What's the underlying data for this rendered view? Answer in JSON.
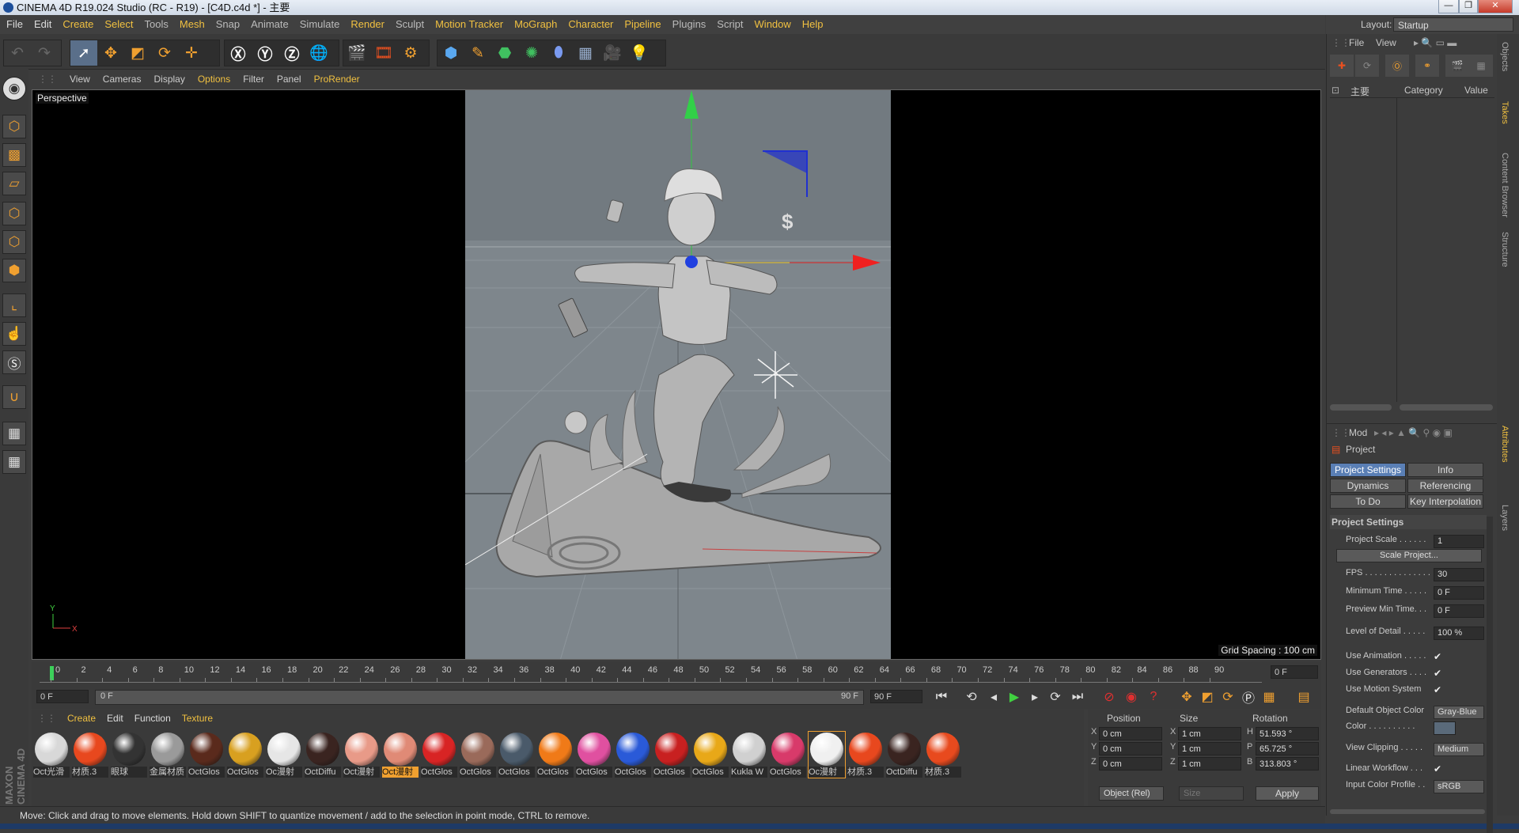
{
  "window": {
    "title": "CINEMA 4D R19.024 Studio (RC - R19) - [C4D.c4d *] - 主要"
  },
  "menubar": [
    "File",
    "Edit",
    "Create",
    "Select",
    "Tools",
    "Mesh",
    "Snap",
    "Animate",
    "Simulate",
    "Render",
    "Sculpt",
    "Motion Tracker",
    "MoGraph",
    "Character",
    "Pipeline",
    "Plugins",
    "Script",
    "Window",
    "Help"
  ],
  "layout": {
    "label": "Layout:",
    "value": "Startup"
  },
  "viewport": {
    "menu": [
      "View",
      "Cameras",
      "Display",
      "Options",
      "Filter",
      "Panel",
      "ProRender"
    ],
    "camera_label": "Perspective",
    "grid_spacing": "Grid Spacing : 100 cm",
    "axis_y": "Y",
    "axis_x": "X"
  },
  "timeline": {
    "ticks": [
      "0",
      "2",
      "4",
      "6",
      "8",
      "10",
      "12",
      "14",
      "16",
      "18",
      "20",
      "22",
      "24",
      "26",
      "28",
      "30",
      "32",
      "34",
      "36",
      "38",
      "40",
      "42",
      "44",
      "46",
      "48",
      "50",
      "52",
      "54",
      "56",
      "58",
      "60",
      "62",
      "64",
      "66",
      "68",
      "70",
      "72",
      "74",
      "76",
      "78",
      "80",
      "82",
      "84",
      "86",
      "88",
      "90"
    ],
    "current_frame": "0 F",
    "start": "0 F",
    "range_start": "0 F",
    "range_end": "90 F",
    "end": "90 F"
  },
  "materials": {
    "menu": [
      "Create",
      "Edit",
      "Function",
      "Texture"
    ],
    "items": [
      {
        "label": "Oct光滑",
        "color": "#d8d8d8"
      },
      {
        "label": "材质.3",
        "color": "#e8481e"
      },
      {
        "label": "眼球",
        "color": "#333333"
      },
      {
        "label": "金属材质",
        "color": "#9a9a9a"
      },
      {
        "label": "OctGlos",
        "color": "#5a2a1c"
      },
      {
        "label": "OctGlos",
        "color": "#d8a020"
      },
      {
        "label": "Oc漫射",
        "color": "#e6e6e6"
      },
      {
        "label": "OctDiffu",
        "color": "#3a2420"
      },
      {
        "label": "Oct漫射",
        "color": "#e89a88"
      },
      {
        "label": "Oct漫射",
        "color": "#e08a76"
      },
      {
        "label": "OctGlos",
        "color": "#d82424"
      },
      {
        "label": "OctGlos",
        "color": "#9a6a5a"
      },
      {
        "label": "OctGlos",
        "color": "#4a5a6a"
      },
      {
        "label": "OctGlos",
        "color": "#f07a18"
      },
      {
        "label": "OctGlos",
        "color": "#e050a0"
      },
      {
        "label": "OctGlos",
        "color": "#2a5ad8"
      },
      {
        "label": "OctGlos",
        "color": "#c82020"
      },
      {
        "label": "OctGlos",
        "color": "#e8a818"
      },
      {
        "label": "Kukla W",
        "color": "#d0d0d0"
      },
      {
        "label": "OctGlos",
        "color": "#d83a6a"
      },
      {
        "label": "Oc漫射",
        "color": "#f0f0f0"
      },
      {
        "label": "材质.3",
        "color": "#e8481e"
      },
      {
        "label": "OctDiffu",
        "color": "#3a2420"
      },
      {
        "label": "材质.3",
        "color": "#e84a1e"
      }
    ]
  },
  "coords": {
    "headers": [
      "Position",
      "Size",
      "Rotation"
    ],
    "rows": [
      {
        "axis": "X",
        "pos": "0 cm",
        "sz_axis": "X",
        "size": "1 cm",
        "rot_axis": "H",
        "rot": "51.593 °"
      },
      {
        "axis": "Y",
        "pos": "0 cm",
        "sz_axis": "Y",
        "size": "1 cm",
        "rot_axis": "P",
        "rot": "65.725 °"
      },
      {
        "axis": "Z",
        "pos": "0 cm",
        "sz_axis": "Z",
        "size": "1 cm",
        "rot_axis": "B",
        "rot": "313.803 °"
      }
    ],
    "mode": "Object (Rel)",
    "size_mode": "Size",
    "apply": "Apply"
  },
  "status": "Move: Click and drag to move elements. Hold down SHIFT to quantize movement / add to the selection in point mode, CTRL to remove.",
  "objects_panel": {
    "menu": [
      "File",
      "View"
    ],
    "col_name": "主要",
    "col_category": "Category",
    "col_value": "Value"
  },
  "attributes": {
    "mode": "Mod",
    "section": "Project",
    "tabs": [
      "Project Settings",
      "Info",
      "Dynamics",
      "Referencing",
      "To Do",
      "Key Interpolation"
    ],
    "group_title": "Project Settings",
    "rows": [
      {
        "label": "Project Scale . . . . . .",
        "value": "1",
        "kind": "field"
      },
      {
        "label": "Scale Project...",
        "kind": "wide-button"
      },
      {
        "label": "FPS . . . . . . . . . . . . . .",
        "value": "30",
        "kind": "field"
      },
      {
        "label": "Minimum Time . . . . .",
        "value": "0 F",
        "kind": "field"
      },
      {
        "label": "Preview Min Time. . .",
        "value": "0 F",
        "kind": "field"
      },
      {
        "label": "Level of Detail . . . . .",
        "value": "100 %",
        "kind": "field"
      },
      {
        "label": "Use Animation . . . . .",
        "value": "✔",
        "kind": "check"
      },
      {
        "label": "Use Generators . . . .",
        "value": "✔",
        "kind": "check"
      },
      {
        "label": "Use Motion System",
        "value": "✔",
        "kind": "check"
      },
      {
        "label": "Default Object Color",
        "value": "Gray-Blue",
        "kind": "button"
      },
      {
        "label": "Color . . . . . . . . . .",
        "value": "",
        "kind": "swatch"
      },
      {
        "label": "View Clipping . . . . .",
        "value": "Medium",
        "kind": "button"
      },
      {
        "label": "Linear Workflow . . .",
        "value": "✔",
        "kind": "check"
      },
      {
        "label": "Input Color Profile . .",
        "value": "sRGB",
        "kind": "button"
      }
    ]
  },
  "side_tabs": [
    "Objects",
    "Takes",
    "Content Browser",
    "Structure",
    "Attributes",
    "Layers"
  ],
  "brand": "MAXON CINEMA 4D"
}
